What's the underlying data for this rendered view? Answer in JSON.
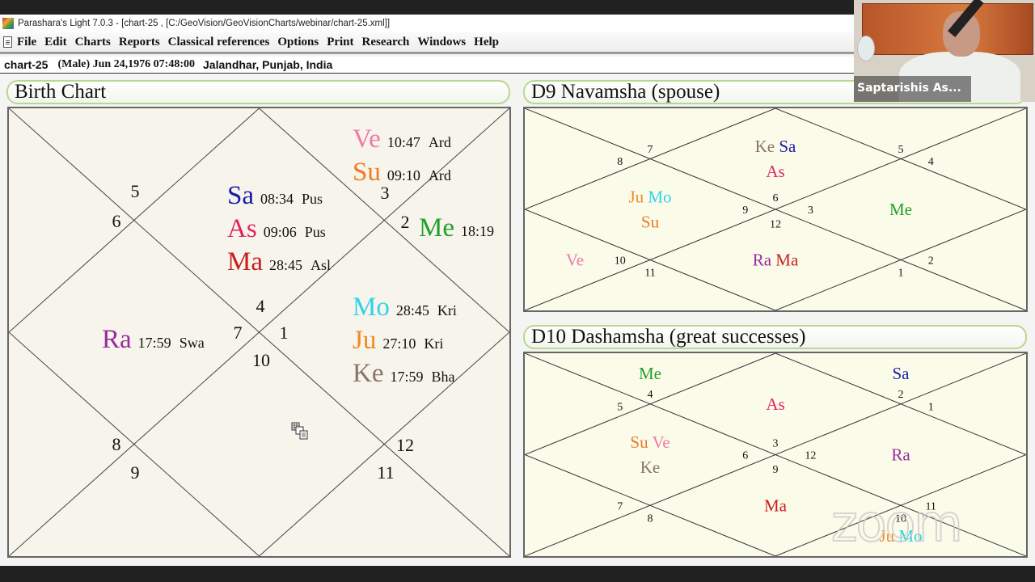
{
  "app": {
    "title": "Parashara's Light 7.0.3 - [chart-25 ,  [C:/GeoVision/GeoVisionCharts/webinar/chart-25.xml]]"
  },
  "menu": [
    "File",
    "Edit",
    "Charts",
    "Reports",
    "Classical references",
    "Options",
    "Print",
    "Research",
    "Windows",
    "Help"
  ],
  "info": {
    "chart_name": "chart-25",
    "gender_date": "(Male) Jun 24,1976 07:48:00",
    "place": "Jalandhar, Punjab, India"
  },
  "planet_colors": {
    "Sa": "#1a1aa8",
    "As": "#e0245e",
    "Ma": "#c81e1e",
    "Ve": "#ee7aa8",
    "Su": "#ee7a22",
    "Me": "#22a02a",
    "Mo": "#2ed3e8",
    "Ju": "#ee8a22",
    "Ke": "#8c7468",
    "Ra": "#9a2aa0"
  },
  "birth_chart": {
    "title": "Birth Chart",
    "houses": [
      {
        "house": 1,
        "sign": "4",
        "planets": [
          {
            "p": "Sa",
            "deg": "08:34",
            "nak": "Pus"
          },
          {
            "p": "As",
            "deg": "09:06",
            "nak": "Pus"
          },
          {
            "p": "Ma",
            "deg": "28:45",
            "nak": "Asl"
          }
        ]
      },
      {
        "house": 2,
        "sign": "5",
        "planets": []
      },
      {
        "house": 3,
        "sign": "6",
        "planets": []
      },
      {
        "house": 4,
        "sign": "7",
        "planets": [
          {
            "p": "Ra",
            "deg": "17:59",
            "nak": "Swa"
          }
        ]
      },
      {
        "house": 5,
        "sign": "8",
        "planets": []
      },
      {
        "house": 6,
        "sign": "9",
        "planets": []
      },
      {
        "house": 7,
        "sign": "10",
        "planets": []
      },
      {
        "house": 8,
        "sign": "11",
        "planets": []
      },
      {
        "house": 9,
        "sign": "12",
        "planets": []
      },
      {
        "house": 10,
        "sign": "1",
        "planets": [
          {
            "p": "Mo",
            "deg": "28:45",
            "nak": "Kri"
          },
          {
            "p": "Ju",
            "deg": "27:10",
            "nak": "Kri"
          },
          {
            "p": "Ke",
            "deg": "17:59",
            "nak": "Bha"
          }
        ]
      },
      {
        "house": 11,
        "sign": "2",
        "planets": [
          {
            "p": "Me",
            "deg": "18:19",
            "nak": ""
          }
        ]
      },
      {
        "house": 12,
        "sign": "3",
        "planets": [
          {
            "p": "Ve",
            "deg": "10:47",
            "nak": "Ard"
          },
          {
            "p": "Su",
            "deg": "09:10",
            "nak": "Ard"
          }
        ]
      }
    ]
  },
  "d9_chart": {
    "title": "D9 Navamsha  (spouse)",
    "houses": [
      {
        "house": 1,
        "sign": "6",
        "planets": [
          [
            "Ke",
            "Sa"
          ],
          [
            "As"
          ]
        ]
      },
      {
        "house": 2,
        "sign": "7",
        "planets": []
      },
      {
        "house": 3,
        "sign": "8",
        "planets": []
      },
      {
        "house": 4,
        "sign": "9",
        "planets": [
          [
            "Ju",
            "Mo"
          ],
          [
            "Su"
          ]
        ]
      },
      {
        "house": 5,
        "sign": "10",
        "planets": [
          [
            "Ve"
          ]
        ]
      },
      {
        "house": 6,
        "sign": "11",
        "planets": []
      },
      {
        "house": 7,
        "sign": "12",
        "planets": [
          [
            "Ra",
            "Ma"
          ]
        ]
      },
      {
        "house": 8,
        "sign": "1",
        "planets": []
      },
      {
        "house": 9,
        "sign": "2",
        "planets": []
      },
      {
        "house": 10,
        "sign": "3",
        "planets": [
          [
            "Me"
          ]
        ]
      },
      {
        "house": 11,
        "sign": "4",
        "planets": []
      },
      {
        "house": 12,
        "sign": "5",
        "planets": []
      }
    ]
  },
  "d10_chart": {
    "title": "D10 Dashamsha  (great successes)",
    "houses": [
      {
        "house": 1,
        "sign": "3",
        "planets": [
          [
            "As"
          ]
        ]
      },
      {
        "house": 2,
        "sign": "4",
        "planets": [
          [
            "Me"
          ]
        ]
      },
      {
        "house": 3,
        "sign": "5",
        "planets": []
      },
      {
        "house": 4,
        "sign": "6",
        "planets": [
          [
            "Su",
            "Ve"
          ],
          [
            "Ke"
          ]
        ]
      },
      {
        "house": 5,
        "sign": "7",
        "planets": []
      },
      {
        "house": 6,
        "sign": "8",
        "planets": []
      },
      {
        "house": 7,
        "sign": "9",
        "planets": [
          [
            "Ma"
          ]
        ]
      },
      {
        "house": 8,
        "sign": "10",
        "planets": [
          [
            "Ju",
            "Mo"
          ]
        ]
      },
      {
        "house": 9,
        "sign": "11",
        "planets": []
      },
      {
        "house": 10,
        "sign": "12",
        "planets": [
          [
            "Ra"
          ]
        ]
      },
      {
        "house": 11,
        "sign": "1",
        "planets": []
      },
      {
        "house": 12,
        "sign": "2",
        "planets": [
          [
            "Sa"
          ]
        ]
      }
    ]
  },
  "video": {
    "participant_name": "Saptarishis As..."
  },
  "watermark": "zoom"
}
